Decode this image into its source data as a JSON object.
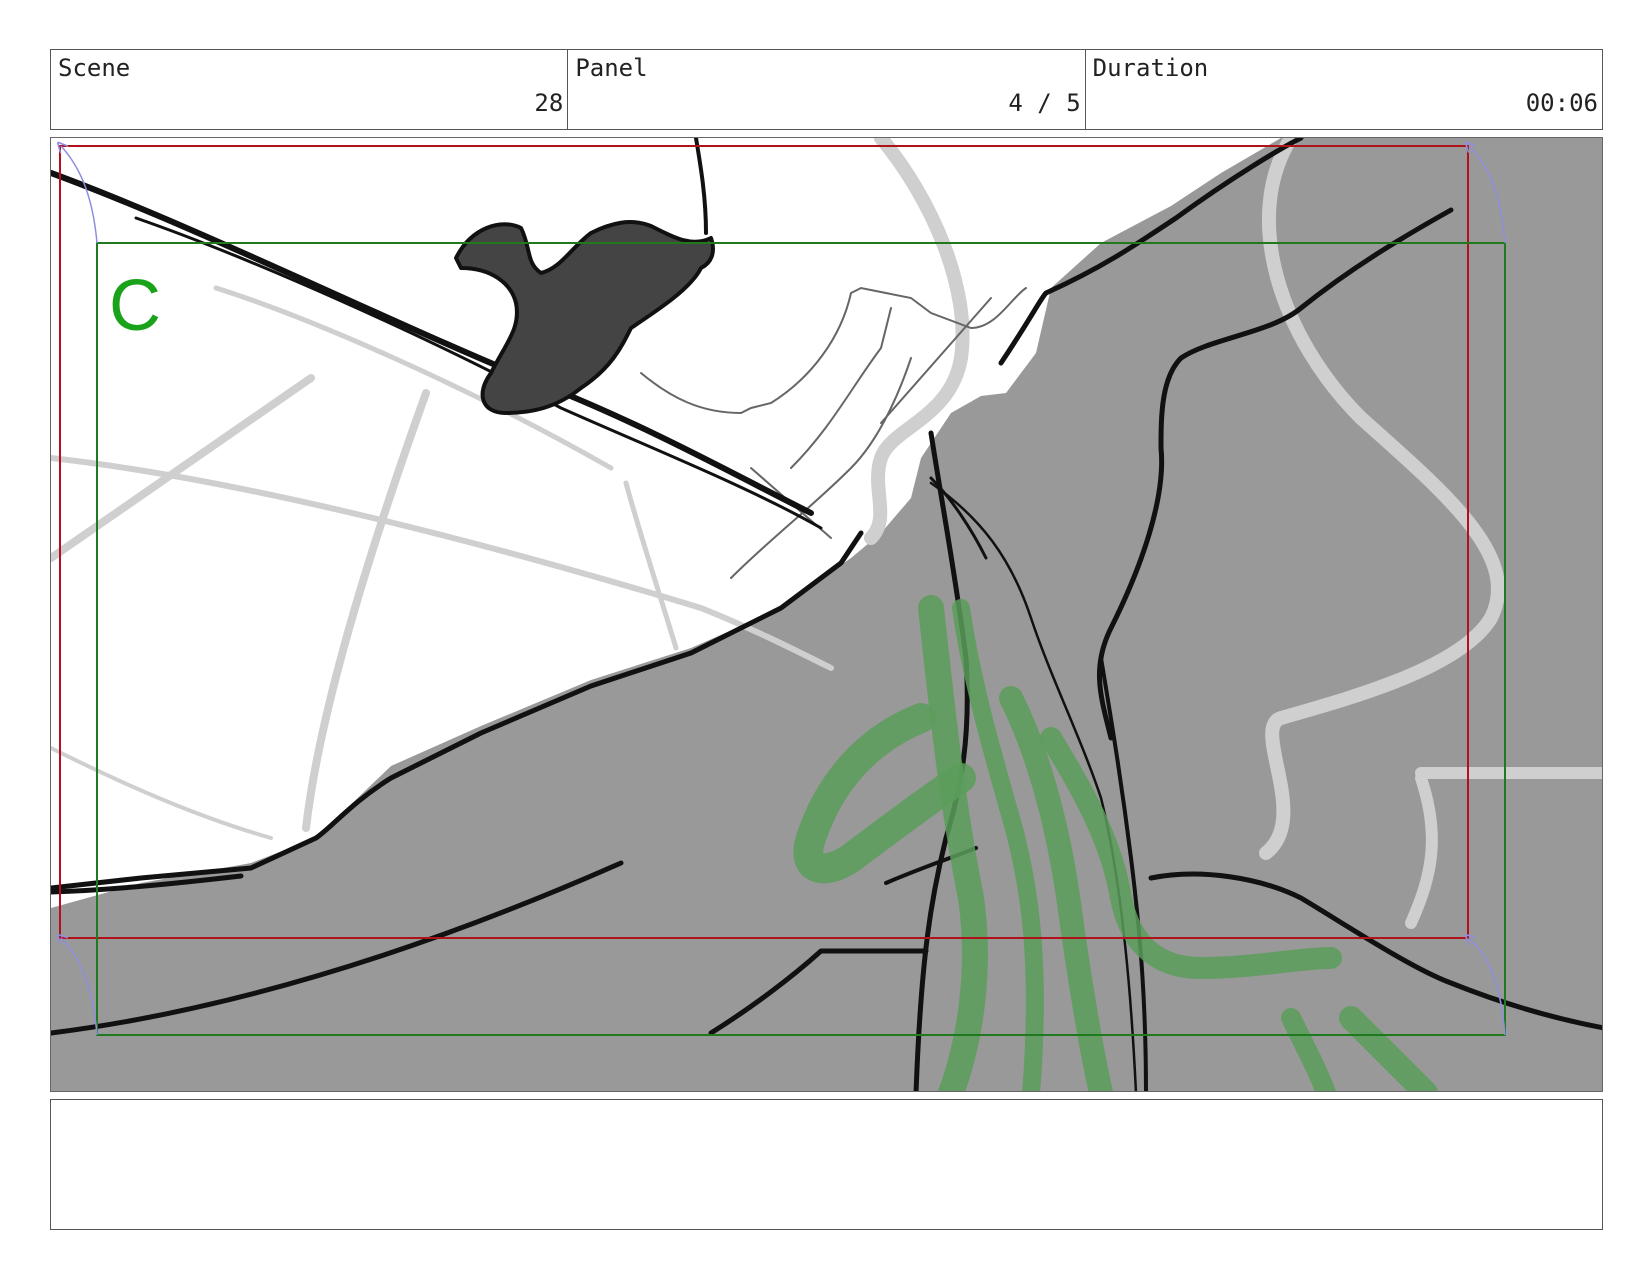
{
  "header": {
    "scene": {
      "label": "Scene",
      "value": "28"
    },
    "panel": {
      "label": "Panel",
      "value": "4 / 5"
    },
    "duration": {
      "label": "Duration",
      "value": "00:06"
    }
  },
  "panel_image": {
    "camera_label": "C",
    "colors": {
      "fill_gray": "#999999",
      "ink": "#111111",
      "guide_gray": "#cfcfcf",
      "safe_frame_red": "#b0121b",
      "camera_frame_green": "#1f7a1f",
      "camera_label_green": "#1aa31a",
      "motion_stroke_green": "#5a9e5a",
      "arrow_blue": "#8e8ee0"
    }
  },
  "notes": {
    "text": ""
  }
}
